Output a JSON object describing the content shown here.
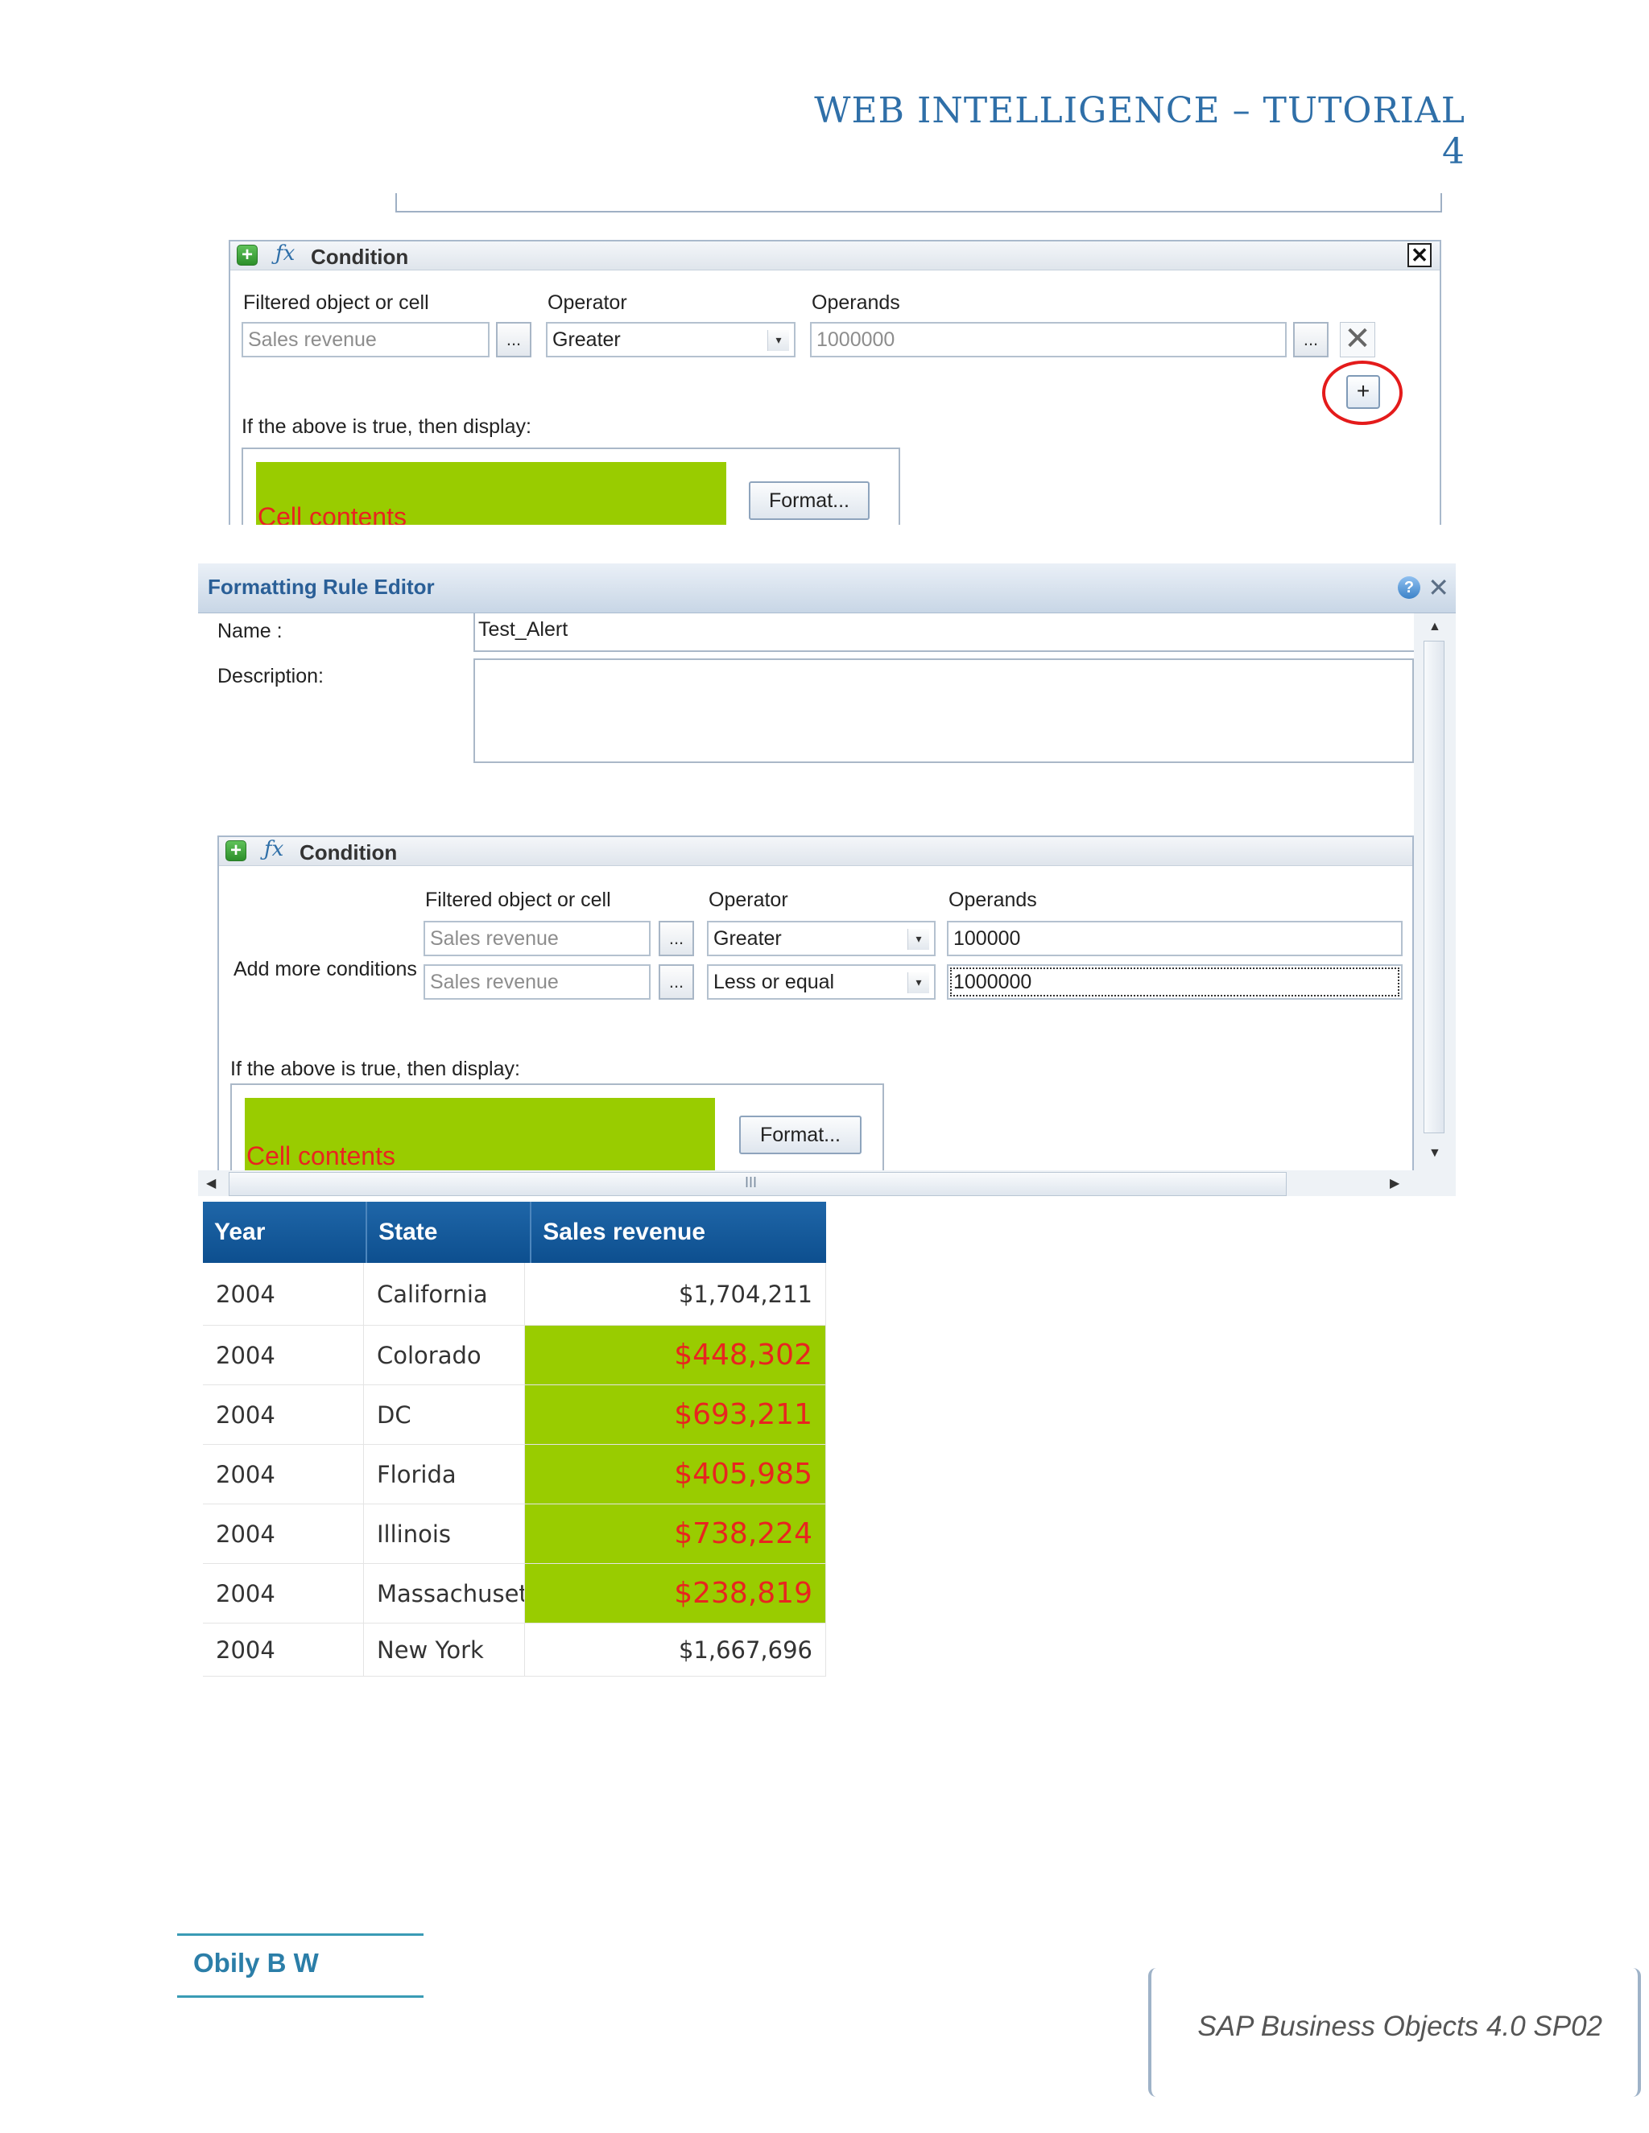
{
  "page": {
    "header_title": "WEB INTELLIGENCE – TUTORIAL 4",
    "author": "Obily B W",
    "footer": "SAP Business Objects 4.0 SP02"
  },
  "shot1": {
    "condition_title": "Condition",
    "col_filtered": "Filtered object or cell",
    "col_operator": "Operator",
    "col_operands": "Operands",
    "filtered_value": "Sales revenue",
    "operator_value": "Greater",
    "operand_value": "1000000",
    "dots_label": "...",
    "display_label": "If the above is true, then display:",
    "preview_text": "Cell contents",
    "format_button": "Format..."
  },
  "shot2": {
    "window_title": "Formatting Rule Editor",
    "name_label": "Name :",
    "name_value": "Test_Alert",
    "description_label": "Description:",
    "condition_title": "Condition",
    "col_filtered": "Filtered object or cell",
    "col_operator": "Operator",
    "col_operands": "Operands",
    "add_more_label": "Add more conditions",
    "conditions": [
      {
        "object": "Sales revenue",
        "operator": "Greater",
        "operand": "100000"
      },
      {
        "object": "Sales revenue",
        "operator": "Less or equal",
        "operand": "1000000"
      }
    ],
    "dots_label": "...",
    "display_label": "If the above is true, then display:",
    "preview_text": "Cell contents",
    "format_button": "Format...",
    "hscroll_grip": "III"
  },
  "table": {
    "headers": [
      "Year",
      "State",
      "Sales revenue"
    ],
    "rows": [
      {
        "year": "2004",
        "state": "California",
        "revenue": "$1,704,211",
        "highlighted": false
      },
      {
        "year": "2004",
        "state": "Colorado",
        "revenue": "$448,302",
        "highlighted": true
      },
      {
        "year": "2004",
        "state": "DC",
        "revenue": "$693,211",
        "highlighted": true
      },
      {
        "year": "2004",
        "state": "Florida",
        "revenue": "$405,985",
        "highlighted": true
      },
      {
        "year": "2004",
        "state": "Illinois",
        "revenue": "$738,224",
        "highlighted": true
      },
      {
        "year": "2004",
        "state": "Massachusetts",
        "revenue": "$238,819",
        "highlighted": true
      },
      {
        "year": "2004",
        "state": "New York",
        "revenue": "$1,667,696",
        "highlighted": false
      }
    ],
    "highlight_color": "#99cc00",
    "highlight_text_color": "#e8251f",
    "header_color": "#1460a0"
  }
}
